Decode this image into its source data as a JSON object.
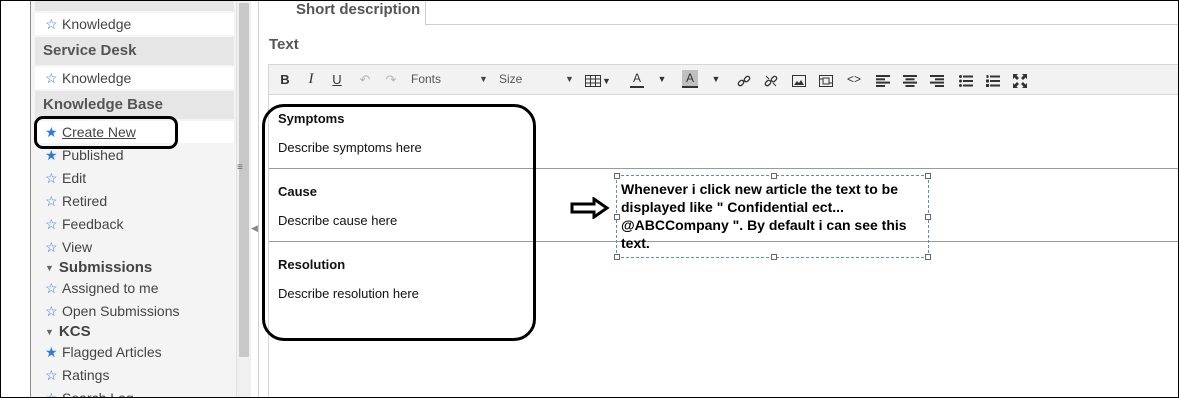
{
  "sidebar": {
    "section_self_service_item": "Knowledge",
    "section_service_desk": "Service Desk",
    "service_desk_item": "Knowledge",
    "section_knowledge_base": "Knowledge Base",
    "kb_items": [
      "Create New",
      "Published",
      "Edit",
      "Retired",
      "Feedback",
      "View"
    ],
    "submissions_label": "Submissions",
    "submissions_items": [
      "Assigned to me",
      "Open Submissions"
    ],
    "kcs_label": "KCS",
    "kcs_items": [
      "Flagged Articles",
      "Ratings",
      "Search Log"
    ]
  },
  "form": {
    "short_description_label": "Short description",
    "text_label": "Text"
  },
  "toolbar": {
    "fonts_label": "Fonts",
    "size_label": "Size",
    "font_color_glyph": "A",
    "bg_color_glyph": "A",
    "buttons": [
      "bold-icon",
      "italic-icon",
      "underline-icon",
      "undo-icon",
      "redo-icon",
      "table-icon",
      "link-icon",
      "unlink-icon",
      "image-icon",
      "video-icon",
      "code-icon",
      "align-left-icon",
      "align-center-icon",
      "align-right-icon",
      "bullet-list-icon",
      "numbered-list-icon",
      "fullscreen-icon"
    ]
  },
  "editor": {
    "symptoms_title": "Symptoms",
    "symptoms_text": "Describe symptoms here",
    "cause_title": "Cause",
    "cause_text": "Describe cause here",
    "resolution_title": "Resolution",
    "resolution_text": "Describe resolution here"
  },
  "annotation": {
    "note": "Whenever i click new article the text to be displayed like \" Confidential ect... @ABCCompany \". By default i can see this text."
  },
  "colors": {
    "star_blue": "#2c7bd8",
    "sidebar_bg": "#f4f4f4",
    "toolbar_bg": "#f2f2f2"
  }
}
